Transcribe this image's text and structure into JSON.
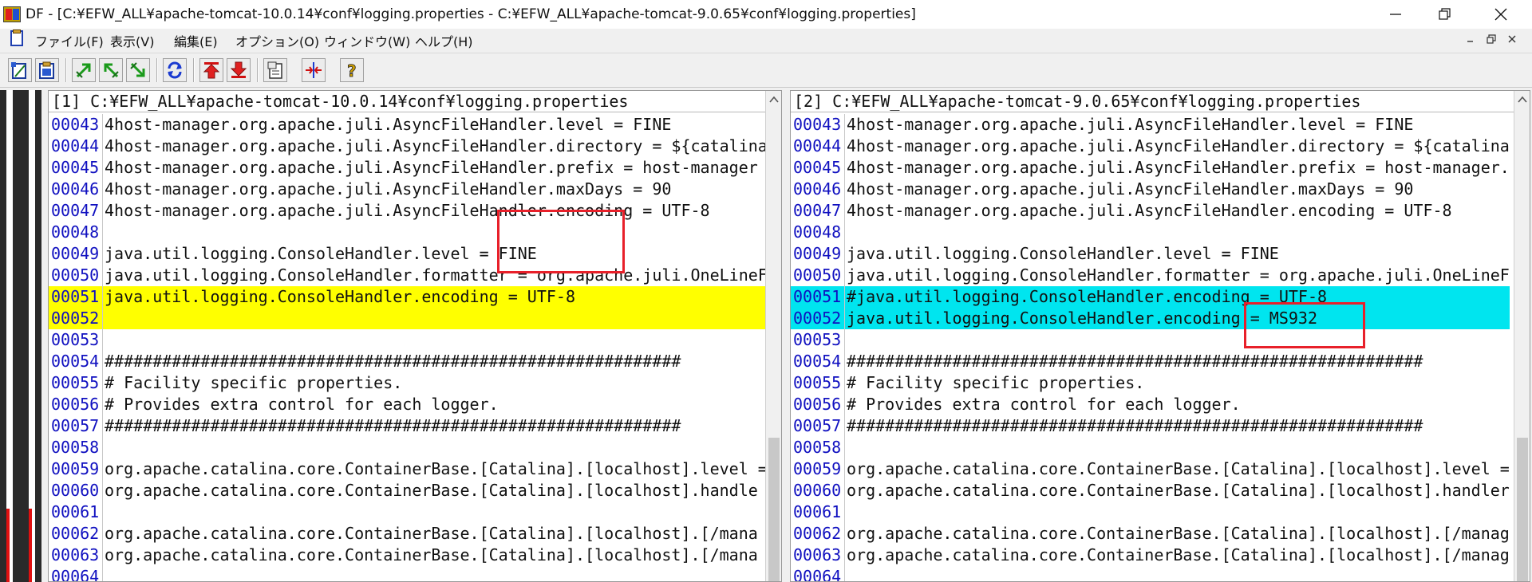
{
  "window": {
    "title": "DF - [C:¥EFW_ALL¥apache-tomcat-10.0.14¥conf¥logging.properties  -  C:¥EFW_ALL¥apache-tomcat-9.0.65¥conf¥logging.properties]",
    "minimize_label": "—",
    "maximize_label": "❐",
    "close_label": "✕"
  },
  "menu": {
    "items": [
      "ファイル(F)",
      "表示(V)",
      "編集(E)",
      "オプション(O)",
      "ウィンドウ(W)",
      "ヘルプ(H)"
    ],
    "mdi": [
      "_",
      "🗗",
      "✕"
    ]
  },
  "toolbar": {
    "buttons": [
      "open-files",
      "paste-files",
      "prev-diff",
      "next-diff",
      "go-diff",
      "refresh",
      "first-diff",
      "last-diff",
      "properties",
      "merge",
      "help"
    ]
  },
  "left_pane": {
    "header": "[1] C:¥EFW_ALL¥apache-tomcat-10.0.14¥conf¥logging.properties",
    "lines": [
      {
        "no": "00043",
        "text": "4host-manager.org.apache.juli.AsyncFileHandler.level = FINE",
        "hl": ""
      },
      {
        "no": "00044",
        "text": "4host-manager.org.apache.juli.AsyncFileHandler.directory = ${catalina",
        "hl": ""
      },
      {
        "no": "00045",
        "text": "4host-manager.org.apache.juli.AsyncFileHandler.prefix = host-manager",
        "hl": ""
      },
      {
        "no": "00046",
        "text": "4host-manager.org.apache.juli.AsyncFileHandler.maxDays = 90",
        "hl": ""
      },
      {
        "no": "00047",
        "text": "4host-manager.org.apache.juli.AsyncFileHandler.encoding = UTF-8",
        "hl": ""
      },
      {
        "no": "00048",
        "text": "",
        "hl": ""
      },
      {
        "no": "00049",
        "text": "java.util.logging.ConsoleHandler.level = FINE",
        "hl": ""
      },
      {
        "no": "00050",
        "text": "java.util.logging.ConsoleHandler.formatter = org.apache.juli.OneLineF",
        "hl": ""
      },
      {
        "no": "00051",
        "text": "java.util.logging.ConsoleHandler.encoding = UTF-8",
        "hl": "yellow"
      },
      {
        "no": "00052",
        "text": "",
        "hl": "yellow"
      },
      {
        "no": "00053",
        "text": "",
        "hl": ""
      },
      {
        "no": "00054",
        "text": "############################################################",
        "hl": ""
      },
      {
        "no": "00055",
        "text": "# Facility specific properties.",
        "hl": ""
      },
      {
        "no": "00056",
        "text": "# Provides extra control for each logger.",
        "hl": ""
      },
      {
        "no": "00057",
        "text": "############################################################",
        "hl": ""
      },
      {
        "no": "00058",
        "text": "",
        "hl": ""
      },
      {
        "no": "00059",
        "text": "org.apache.catalina.core.ContainerBase.[Catalina].[localhost].level =",
        "hl": ""
      },
      {
        "no": "00060",
        "text": "org.apache.catalina.core.ContainerBase.[Catalina].[localhost].handle",
        "hl": ""
      },
      {
        "no": "00061",
        "text": "",
        "hl": ""
      },
      {
        "no": "00062",
        "text": "org.apache.catalina.core.ContainerBase.[Catalina].[localhost].[/mana",
        "hl": ""
      },
      {
        "no": "00063",
        "text": "org.apache.catalina.core.ContainerBase.[Catalina].[localhost].[/mana",
        "hl": ""
      },
      {
        "no": "00064",
        "text": "",
        "hl": ""
      }
    ]
  },
  "right_pane": {
    "header": "[2] C:¥EFW_ALL¥apache-tomcat-9.0.65¥conf¥logging.properties",
    "lines": [
      {
        "no": "00043",
        "text": "4host-manager.org.apache.juli.AsyncFileHandler.level = FINE",
        "hl": ""
      },
      {
        "no": "00044",
        "text": "4host-manager.org.apache.juli.AsyncFileHandler.directory = ${catalina",
        "hl": ""
      },
      {
        "no": "00045",
        "text": "4host-manager.org.apache.juli.AsyncFileHandler.prefix = host-manager.",
        "hl": ""
      },
      {
        "no": "00046",
        "text": "4host-manager.org.apache.juli.AsyncFileHandler.maxDays = 90",
        "hl": ""
      },
      {
        "no": "00047",
        "text": "4host-manager.org.apache.juli.AsyncFileHandler.encoding = UTF-8",
        "hl": ""
      },
      {
        "no": "00048",
        "text": "",
        "hl": ""
      },
      {
        "no": "00049",
        "text": "java.util.logging.ConsoleHandler.level = FINE",
        "hl": ""
      },
      {
        "no": "00050",
        "text": "java.util.logging.ConsoleHandler.formatter = org.apache.juli.OneLineF",
        "hl": ""
      },
      {
        "no": "00051",
        "text": "#java.util.logging.ConsoleHandler.encoding = UTF-8",
        "hl": "cyan"
      },
      {
        "no": "00052",
        "text": "java.util.logging.ConsoleHandler.encoding = MS932",
        "hl": "cyan"
      },
      {
        "no": "00053",
        "text": "",
        "hl": ""
      },
      {
        "no": "00054",
        "text": "############################################################",
        "hl": ""
      },
      {
        "no": "00055",
        "text": "# Facility specific properties.",
        "hl": ""
      },
      {
        "no": "00056",
        "text": "# Provides extra control for each logger.",
        "hl": ""
      },
      {
        "no": "00057",
        "text": "############################################################",
        "hl": ""
      },
      {
        "no": "00058",
        "text": "",
        "hl": ""
      },
      {
        "no": "00059",
        "text": "org.apache.catalina.core.ContainerBase.[Catalina].[localhost].level =",
        "hl": ""
      },
      {
        "no": "00060",
        "text": "org.apache.catalina.core.ContainerBase.[Catalina].[localhost].handler",
        "hl": ""
      },
      {
        "no": "00061",
        "text": "",
        "hl": ""
      },
      {
        "no": "00062",
        "text": "org.apache.catalina.core.ContainerBase.[Catalina].[localhost].[/manag",
        "hl": ""
      },
      {
        "no": "00063",
        "text": "org.apache.catalina.core.ContainerBase.[Catalina].[localhost].[/manag",
        "hl": ""
      },
      {
        "no": "00064",
        "text": "",
        "hl": ""
      }
    ]
  },
  "colors": {
    "diff_left": "#ffff00",
    "diff_right": "#00e5ef",
    "line_number": "#1010c0",
    "annotation_box": "#e8202a"
  }
}
